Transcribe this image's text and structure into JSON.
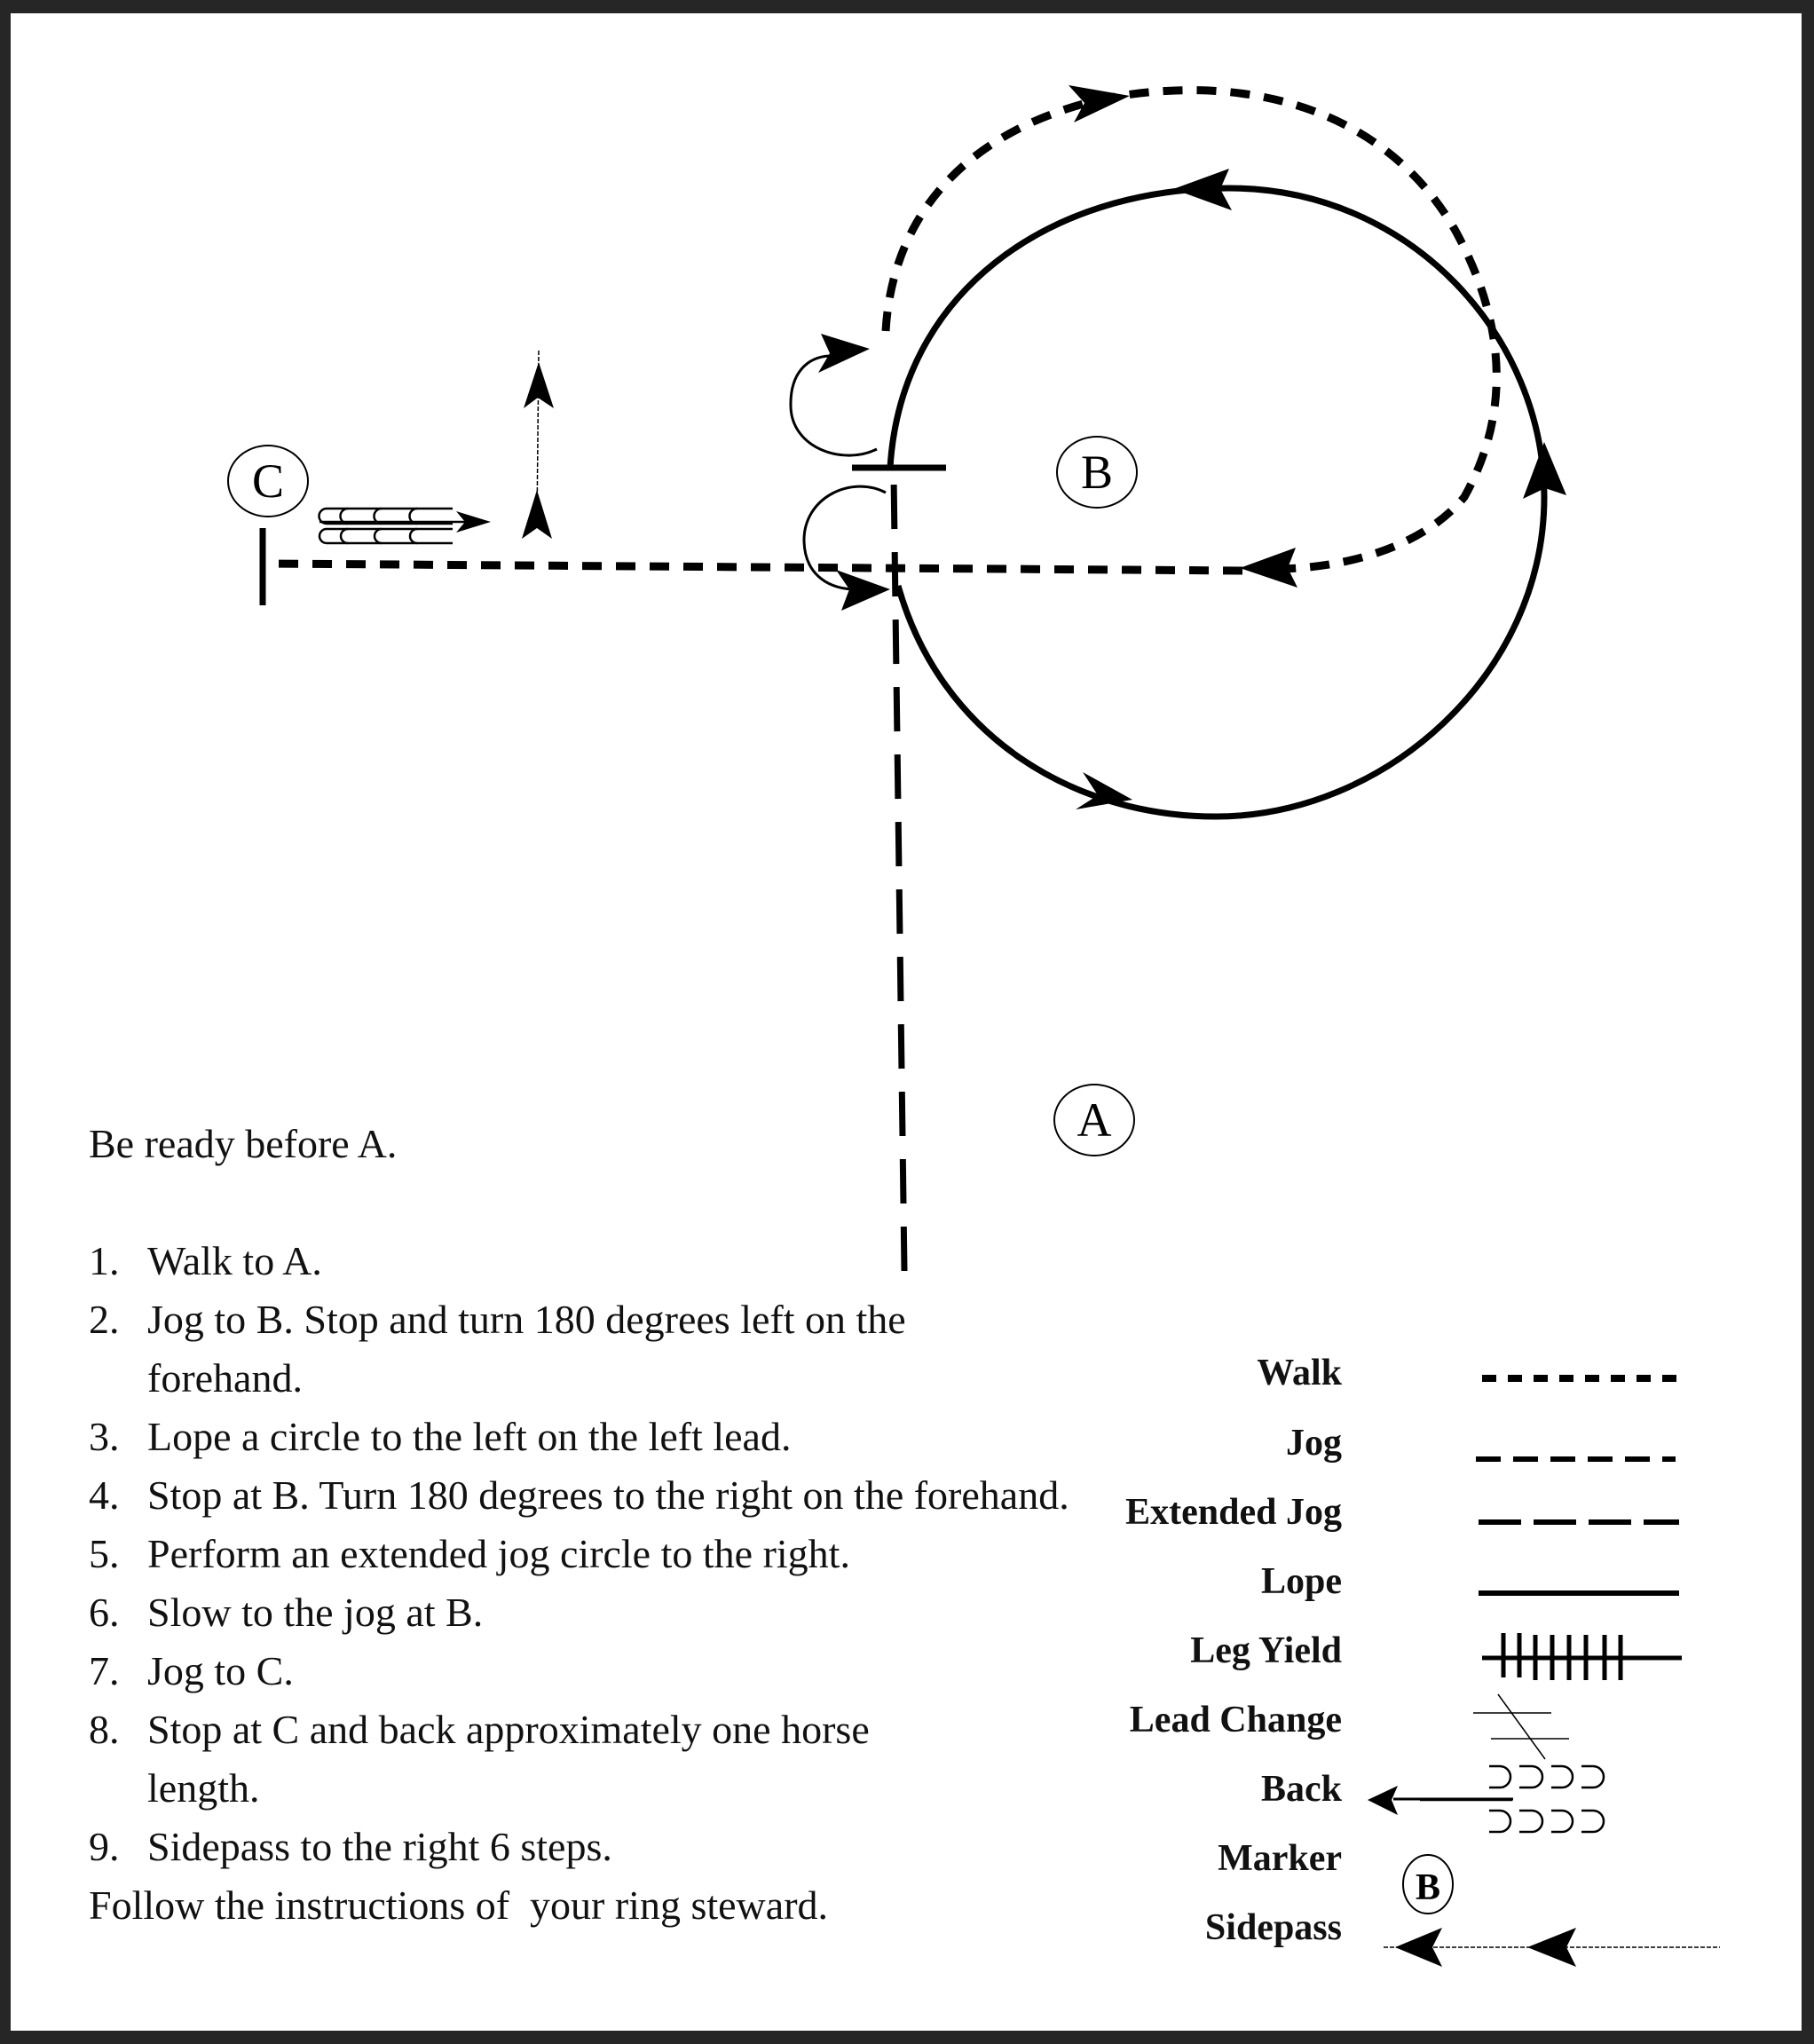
{
  "pattern": {
    "markers": [
      {
        "id": "A",
        "label": "A"
      },
      {
        "id": "B",
        "label": "B"
      },
      {
        "id": "C",
        "label": "C"
      }
    ],
    "intro": "Be ready before A.",
    "steps": [
      {
        "num": "1.",
        "text": "Walk to A."
      },
      {
        "num": "2.",
        "text": "Jog to B.  Stop and turn 180 degrees left on the forehand."
      },
      {
        "num": "3.",
        "text": "Lope a circle to the left on the left lead."
      },
      {
        "num": "4.",
        "text": "Stop at B.  Turn 180 degrees to the right on the forehand."
      },
      {
        "num": "5.",
        "text": "Perform an extended jog circle to the right."
      },
      {
        "num": "6.",
        "text": "Slow to the jog at B."
      },
      {
        "num": "7.",
        "text": "Jog to C."
      },
      {
        "num": "8.",
        "text": "Stop at C and back approximately one horse length."
      },
      {
        "num": "9.",
        "text": "Sidepass to the right 6 steps."
      }
    ],
    "closing": "Follow the instructions of  your ring steward."
  },
  "legend": {
    "items": [
      {
        "key": "walk",
        "label": "Walk"
      },
      {
        "key": "jog",
        "label": "Jog"
      },
      {
        "key": "extended_jog",
        "label": "Extended Jog"
      },
      {
        "key": "lope",
        "label": "Lope"
      },
      {
        "key": "leg_yield",
        "label": "Leg Yield"
      },
      {
        "key": "lead_change",
        "label": "Lead Change"
      },
      {
        "key": "back",
        "label": "Back"
      },
      {
        "key": "marker",
        "label": "Marker"
      },
      {
        "key": "sidepass",
        "label": "Sidepass"
      }
    ],
    "marker_sample": "B"
  },
  "colors": {
    "frame": "#262626",
    "paper": "#ffffff",
    "ink": "#000000"
  }
}
